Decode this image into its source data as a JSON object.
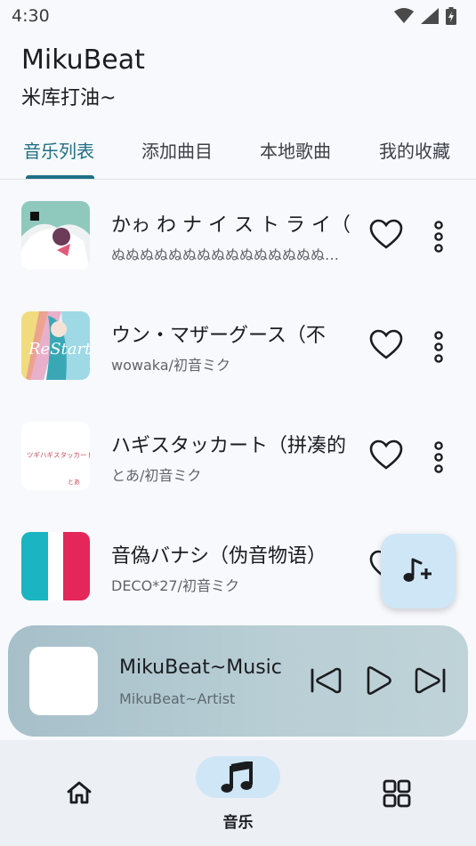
{
  "status": {
    "time": "4:30"
  },
  "app": {
    "title": "MikuBeat",
    "subtitle": "米库打油~"
  },
  "tabs": [
    {
      "label": "音乐列表",
      "active": true
    },
    {
      "label": "添加曲目",
      "active": false
    },
    {
      "label": "本地歌曲",
      "active": false
    },
    {
      "label": "我的收藏",
      "active": false
    }
  ],
  "songs": [
    {
      "title": "かゎ わ ナ イ ス ト ラ イ（",
      "artist": "ぬぬぬぬぬぬぬぬぬぬぬぬぬぬぬぬぬぬぬぬ..."
    },
    {
      "title": "ウン・マザーグース（不",
      "artist": "wowaka/初音ミク"
    },
    {
      "title": "ハギスタッカート（拼凑的",
      "artist": "とあ/初音ミク"
    },
    {
      "title": "音偽バナシ（伪音物语）",
      "artist": "DECO*27/初音ミク"
    }
  ],
  "player": {
    "title": "MikuBeat~Music",
    "artist": "MikuBeat~Artist"
  },
  "nav": {
    "music_label": "音乐"
  },
  "colors": {
    "accent": "#1f6f84",
    "fab_bg": "#cfe6f7"
  }
}
